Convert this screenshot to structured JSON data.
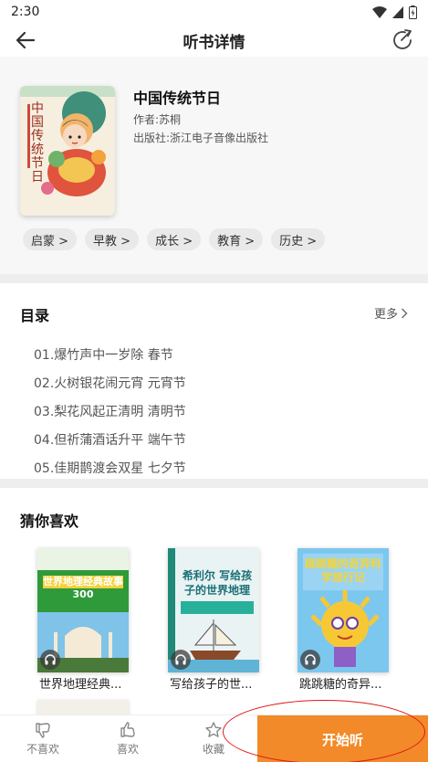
{
  "status_bar": {
    "time": "2:30"
  },
  "nav": {
    "title": "听书详情"
  },
  "book": {
    "title": "中国传统节日",
    "author": "作者:苏桐",
    "publisher": "出版社:浙江电子音像出版社",
    "cover_text": "中国传统节日",
    "tags": [
      "启蒙 >",
      "早教 >",
      "成长 >",
      "教育 >",
      "历史 >"
    ]
  },
  "toc": {
    "title": "目录",
    "more": "更多",
    "items": [
      "01.爆竹声中一岁除 春节",
      "02.火树银花闹元宵 元宵节",
      "03.梨花风起正清明 清明节",
      "04.但祈蒲酒话升平 端午节",
      "05.佳期鹊渡会双星 七夕节"
    ]
  },
  "recommend": {
    "title": "猜你喜欢",
    "items": [
      {
        "name": "世界地理经典...",
        "cover_text": "世界地理经典故事300"
      },
      {
        "name": "写给孩子的世...",
        "cover_text": "希利尔 写给孩子的世界地理"
      },
      {
        "name": "跳跳糖的奇异...",
        "cover_text": "跳跳糖的奇异科学旅行记"
      }
    ]
  },
  "bottom_bar": {
    "dislike": "不喜欢",
    "like": "喜欢",
    "favorite": "收藏",
    "listen": "开始听"
  },
  "colors": {
    "accent": "#f28a29",
    "annotation": "#e01818"
  }
}
